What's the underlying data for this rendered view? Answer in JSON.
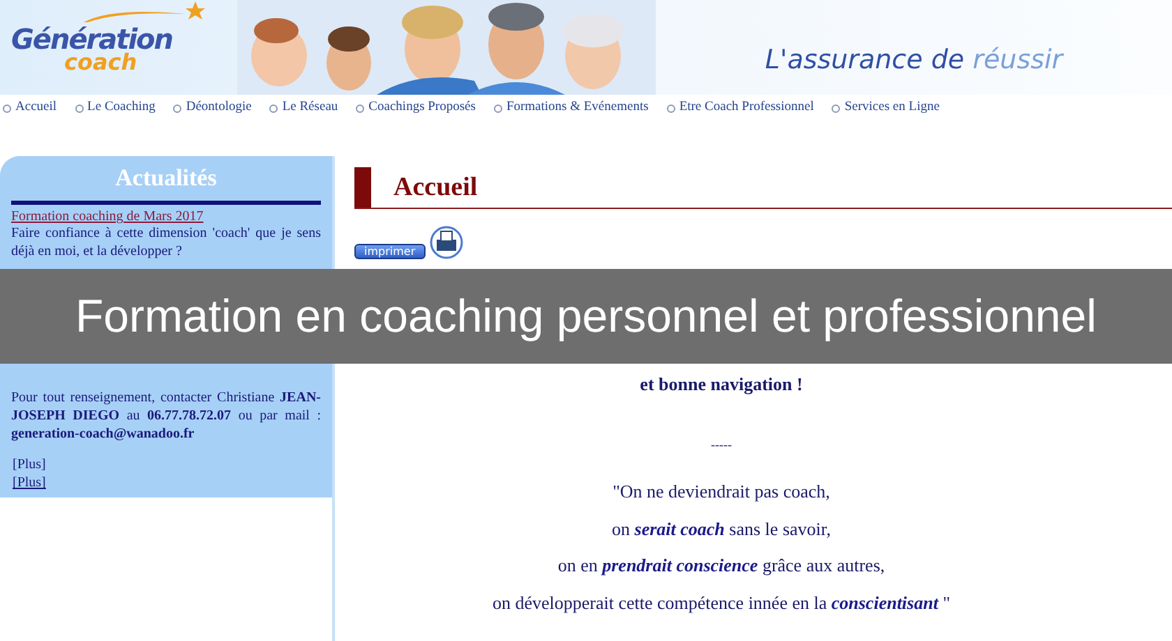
{
  "header": {
    "logo": {
      "line1": "Génération",
      "line2": "coach"
    },
    "tagline": "L'assurance de **réussir**"
  },
  "nav": [
    {
      "label": "Accueil"
    },
    {
      "label": "Le Coaching"
    },
    {
      "label": "Déontologie"
    },
    {
      "label": "Le Réseau"
    },
    {
      "label": "Coachings Proposés"
    },
    {
      "label": "Formations & Evénements"
    },
    {
      "label": "Etre Coach Professionnel"
    },
    {
      "label": "Services en Ligne"
    }
  ],
  "sidebar": {
    "title": "Actualités",
    "news_link": "Formation coaching de Mars 2017",
    "intro": "Faire confiance à cette dimension 'coach' que je sens déjà en moi, et la développer ?",
    "contact": "Pour tout renseignement, contacter Christiane **JEAN-JOSEPH DIEGO** au **06.77.78.72.07** ou par mail : **generation-coach@wanadoo.fr**",
    "more_links": [
      {
        "label": "[Plus]",
        "underlined": false
      },
      {
        "label": "[Plus]",
        "underlined": true
      }
    ]
  },
  "main": {
    "heading": "Accueil",
    "print_button": "imprimer",
    "welcome_sub": "et bonne navigation !",
    "separator": "-----",
    "quote_lines": [
      "\"On ne deviendrait pas coach,",
      "on **serait coach** sans le savoir,",
      "on en **prendrait conscience** grâce aux autres,",
      "on développerait cette compétence innée en la **conscientisant** \""
    ]
  },
  "banner": {
    "text": "Formation en coaching personnel et professionnel"
  }
}
